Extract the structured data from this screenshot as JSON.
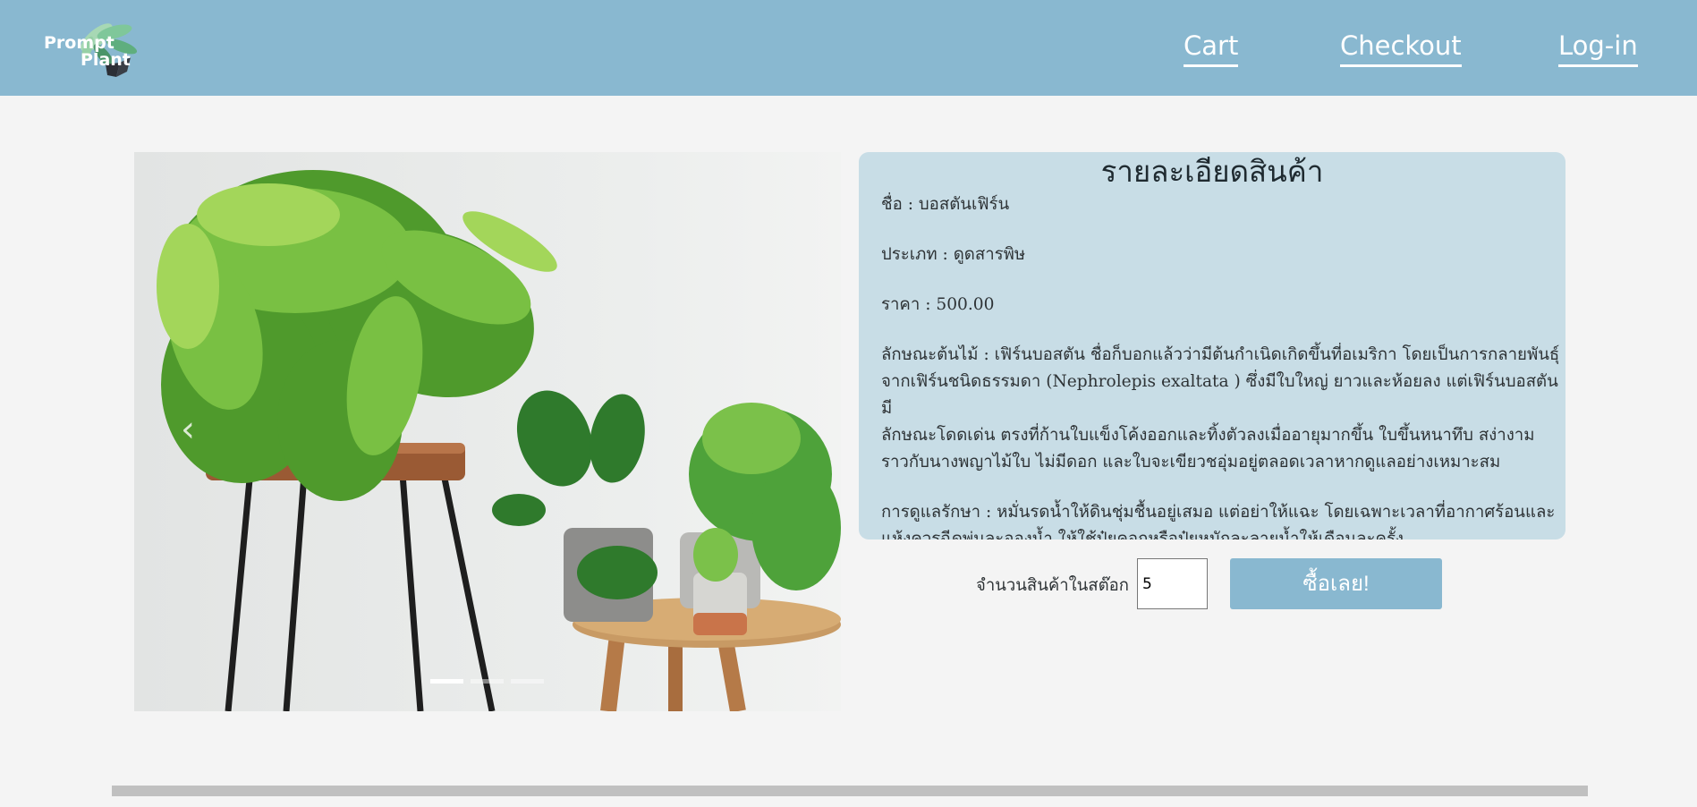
{
  "brand": {
    "line1": "Prompt",
    "line2": "Plant"
  },
  "nav": {
    "cart": "Cart",
    "checkout": "Checkout",
    "login": "Log-in"
  },
  "carousel": {
    "prev": "‹",
    "slide_count": 3,
    "active_slide": 0
  },
  "details": {
    "title": "รายละเอียดสินค้า",
    "name": "ชื่อ : บอสตันเฟิร์น",
    "type": "ประเภท : ดูดสารพิษ",
    "price": "ราคา : 500.00",
    "traits_1": "ลักษณะต้นไม้ : เฟิร์นบอสตัน ชื่อก็บอกแล้วว่ามีต้นกำเนิดเกิดขึ้นที่อเมริกา โดยเป็นการกลายพันธุ์",
    "traits_2": "จากเฟิร์นชนิดธรรมดา (Nephrolepis exaltata ) ซึ่งมีใบใหญ่ ยาวและห้อยลง แต่เฟิร์นบอสตัน มี",
    "traits_3": "ลักษณะโดดเด่น ตรงที่ก้านใบแข็งโค้งออกและทิ้งตัวลงเมื่ออายุมากขึ้น ใบขึ้นหนาทึบ สง่างาม",
    "traits_4": "ราวกับนางพญาไม้ใบ ไม่มีดอก และใบจะเขียวชอุ่มอยู่ตลอดเวลาหากดูแลอย่างเหมาะสม",
    "care_1": "การดูแลรักษา : หมั่นรดน้ำให้ดินชุ่มชื้นอยู่เสมอ แต่อย่าให้แฉะ โดยเฉพาะเวลาที่อากาศร้อนและ",
    "care_2": "แห้งควรฉีดพ่นละอองน้ำ ให้ใช้ปุ๋ยคอกหรือปุ๋ยหมักละลายน้ำให้เดือนละครั้ง"
  },
  "purchase": {
    "stock_label": "จำนวนสินค้าในสต๊อก",
    "quantity": "5",
    "buy_label": "ซื้อเลย!"
  },
  "colors": {
    "navbar": "#89b8d0",
    "details_bg": "#c8dde6",
    "page_bg": "#f4f4f4",
    "footer": "#c0c0c0"
  }
}
